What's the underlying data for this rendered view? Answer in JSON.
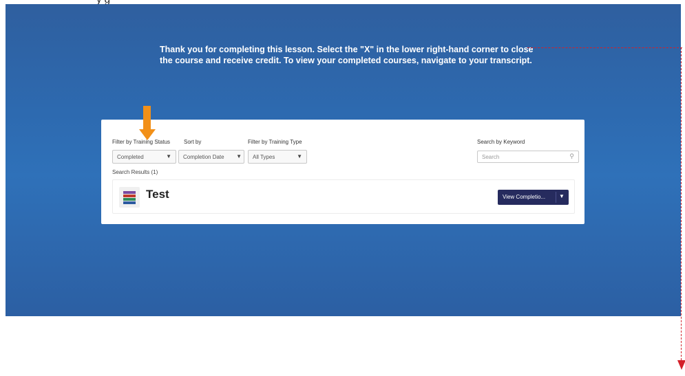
{
  "caption": "y       g",
  "slide": {
    "message": "Thank you for completing this lesson. Select the \"X\" in the lower right-hand corner to close the course and receive credit. To view your completed courses, navigate to your transcript."
  },
  "panel": {
    "filter_status_label": "Filter by Training Status",
    "sort_label": "Sort by",
    "filter_type_label": "Filter by Training Type",
    "search_label": "Search by Keyword",
    "status_value": "Completed",
    "sort_value": "Completion Date",
    "type_value": "All Types",
    "search_placeholder": "Search",
    "results_label": "Search Results (1)",
    "course_title": "Test",
    "view_button_label": "View Completio...",
    "dropdown_caret": "▼"
  },
  "icons": {
    "search": "search-icon",
    "thumb": "course-thumbnail-icon",
    "arrow_orange": "down-arrow-icon",
    "arrow_red": "down-arrow-icon"
  },
  "colors": {
    "slide_blue": "#2f6bb2",
    "orange": "#f29018",
    "red": "#d4202a",
    "button_navy": "#262b5e"
  }
}
